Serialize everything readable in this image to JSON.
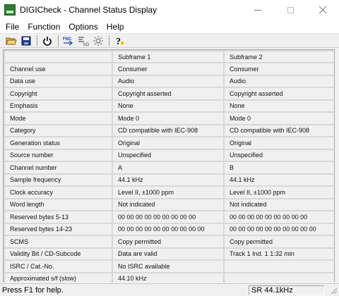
{
  "window": {
    "title": "DIGICheck - Channel Status Display"
  },
  "menu": [
    "File",
    "Function",
    "Options",
    "Help"
  ],
  "toolbar": {
    "buttons": [
      {
        "name": "open-folder-icon"
      },
      {
        "name": "save-disk-icon"
      },
      {
        "name": "power-icon"
      },
      {
        "name": "function-icon"
      },
      {
        "name": "io-settings-icon"
      },
      {
        "name": "light-icon"
      },
      {
        "name": "help-icon"
      }
    ]
  },
  "table": {
    "headers": [
      "",
      "Subframe 1",
      "Subframe 2"
    ],
    "rows": [
      [
        "Channel use",
        "Consumer",
        "Consumer"
      ],
      [
        "Data use",
        "Audio",
        "Audio"
      ],
      [
        "Copyright",
        "Copyright asserted",
        "Copyright asserted"
      ],
      [
        "Emphasis",
        "None",
        "None"
      ],
      [
        "Mode",
        "Mode 0",
        "Mode 0"
      ],
      [
        "Category",
        "CD compatible with IEC-908",
        "CD compatible with IEC-908"
      ],
      [
        "Generation status",
        "Original",
        "Original"
      ],
      [
        "Source number",
        "Unspecified",
        "Unspecified"
      ],
      [
        "Channel number",
        "A",
        "B"
      ],
      [
        "Sample frequency",
        "44.1 kHz",
        "44.1 kHz"
      ],
      [
        "Clock accuracy",
        "Level II, ±1000 ppm",
        "Level II, ±1000 ppm"
      ],
      [
        "Word length",
        "Not indicated",
        "Not indicated"
      ],
      [
        "Reserved bytes 5-13",
        "00 00 00 00 00 00 00 00 00",
        "00 00 00 00 00 00 00 00 00"
      ],
      [
        "Reserved bytes 14-23",
        "00 00 00 00 00 00 00 00 00 00",
        "00 00 00 00 00 00 00 00 00 00"
      ],
      [
        "SCMS",
        "Copy permitted",
        "Copy permitted"
      ],
      [
        "Validity Bit / CD-Subcode",
        "Data are valid",
        "Track  1 Ind.  1    1:32 min"
      ],
      [
        "ISRC / Cat.-No.",
        "No ISRC available",
        ""
      ],
      [
        "Approximated s/f (slow)",
        "44.10 kHz",
        ""
      ]
    ]
  },
  "status": {
    "help": "Press F1 for help.",
    "sample_rate": "SR 44.1kHz"
  },
  "colors": {
    "app_icon": "#2e7d32",
    "cell_bg": "#f0f0f0",
    "grid_line": "#d8d8d8"
  }
}
